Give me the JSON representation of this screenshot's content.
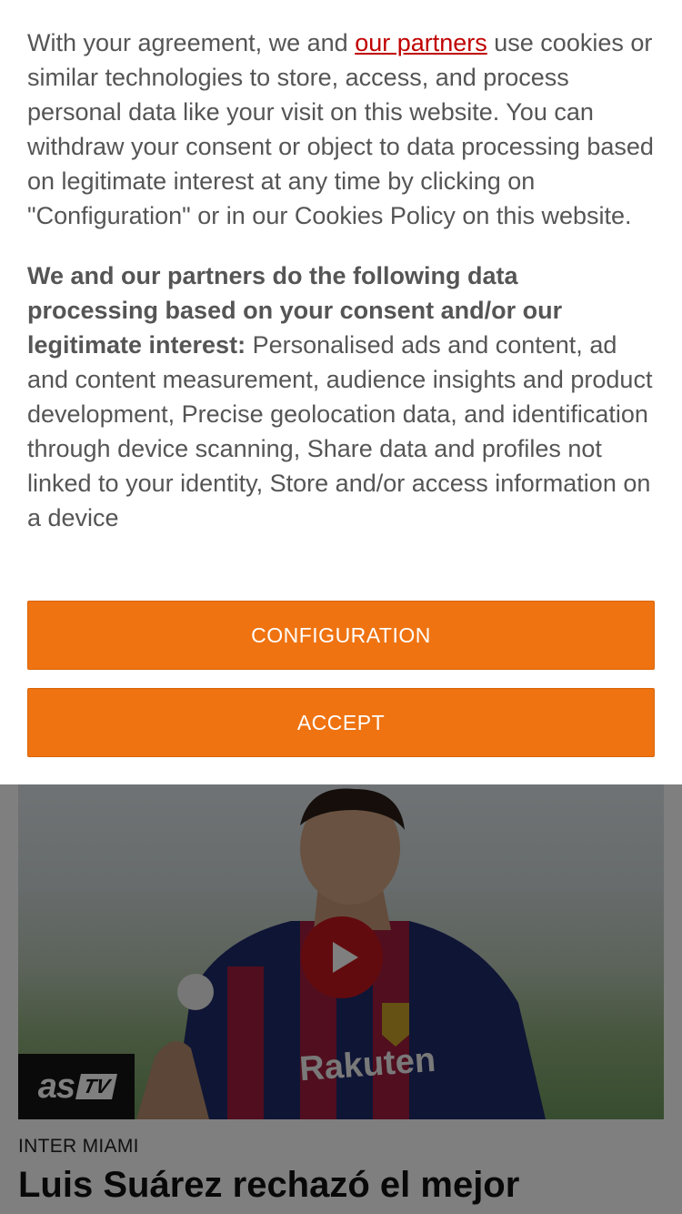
{
  "consent": {
    "intro_before_link": "With your agreement, we and ",
    "partners_link": "our partners",
    "intro_after_link": " use cookies or similar technologies to store, access, and process personal data like your visit on this website. You can withdraw your consent or object to data processing based on legitimate interest at any time by clicking on \"Configuration\" or in our Cookies Policy on this website.",
    "purposes_heading": "We and our partners do the following data processing based on your consent and/or our legitimate interest:",
    "purposes_list": " Personalised ads and content, ad and content measurement, audience insights and product development, Precise geolocation data, and identification through device scanning, Share data and profiles not linked to your identity, Store and/or access information on a device",
    "configuration_label": "CONFIGURATION",
    "accept_label": "ACCEPT"
  },
  "article": {
    "video_badge_as": "as",
    "video_badge_tv": "TV",
    "section": "INTER MIAMI",
    "headline": "Luis Suárez rechazó el mejor"
  },
  "colors": {
    "accent_button": "#ef7311",
    "link": "#c00000",
    "play_button": "#c4161c",
    "badge_bg": "#141414"
  },
  "icons": [
    "play-icon"
  ]
}
